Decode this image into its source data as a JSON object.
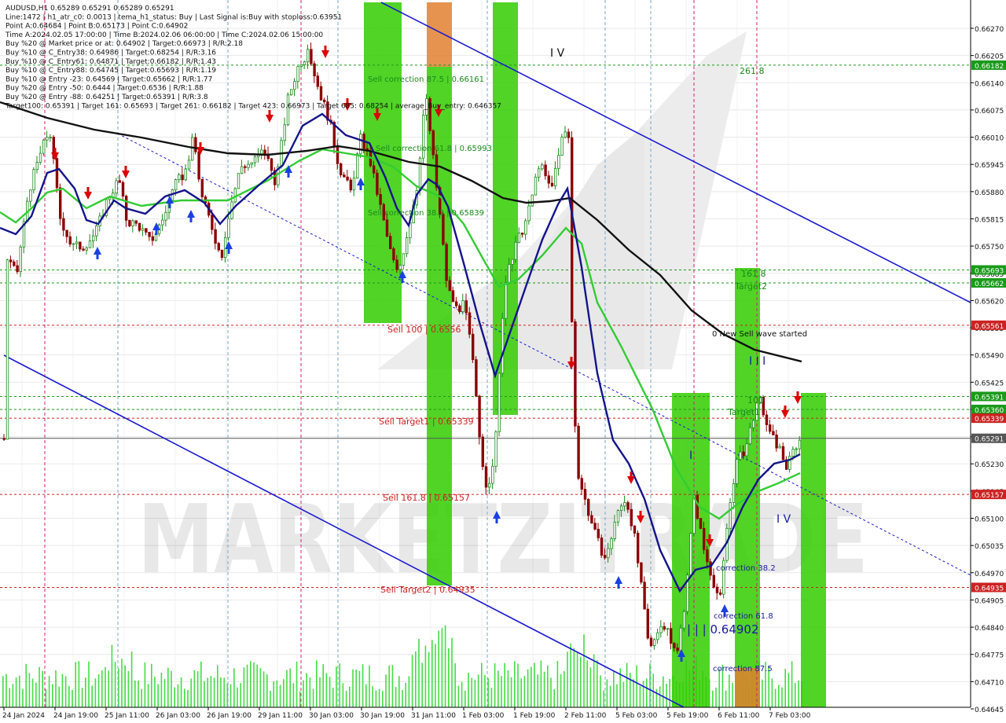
{
  "header": {
    "lines": [
      "AUDUSD,H1  0.65289 0.65291 0.65289 0.65291",
      "Line:1472  | h1_atr_c0: 0.0013 | tema_h1_status: Buy | Last Signal is:Buy with stoploss:0.63951",
      "Point A:0.64684 | Point B:0.65173 | Point C:0.64902",
      "Time A:2024.02.05 17:00:00 | Time B:2024.02.06 06:00:00 | Time C:2024.02.06 15:00:00",
      "Buy %20 @ Market price or at: 0.64902 | Target:0.66973 | R/R:2.18",
      "Buy %10 @ C_Entry38: 0.64986 | Target:0.68254 | R/R:3.16",
      "Buy %10 @ C_Entry61: 0.64871 | Target:0.66182 | R/R:1.43",
      "Buy %10 @ C_Entry88: 0.64745 | Target:0.65693 | R/R:1.19",
      "Buy %10 @ Entry -23: 0.64569 | Target:0.65662 | R/R:1.77",
      "Buy %20 @ Entry -50: 0.6444 | Target:0.6536 | R/R:1.88",
      "Buy %20 @ Entry -88: 0.64251 | Target:0.65391 | R/R:3.8",
      "Target100: 0.65391 | Target 161: 0.65693 | Target 261: 0.66182 | Target 423: 0.66973 | Target 685: 0.68254 | average_Buy_entry: 0.646357"
    ]
  },
  "watermark": "MARKETZITRADE",
  "chart_data": {
    "type": "candlestick",
    "symbol": "AUDUSD",
    "timeframe": "H1",
    "ylim": [
      0.64645,
      0.66295
    ],
    "y_ticks": [
      "0.66270",
      "0.66205",
      "0.66140",
      "0.66075",
      "0.66010",
      "0.65945",
      "0.65880",
      "0.65815",
      "0.65750",
      "0.65685",
      "0.65620",
      "0.65555",
      "0.65490",
      "0.65425",
      "0.65360",
      "0.65295",
      "0.65230",
      "0.65165",
      "0.65100",
      "0.65035",
      "0.64970",
      "0.64905",
      "0.64840",
      "0.64775",
      "0.64710",
      "0.64645"
    ],
    "x_ticks": [
      "24 Jan 2024",
      "24 Jan 19:00",
      "25 Jan 11:00",
      "26 Jan 03:00",
      "26 Jan 19:00",
      "29 Jan 11:00",
      "30 Jan 03:00",
      "30 Jan 19:00",
      "31 Jan 11:00",
      "1 Feb 03:00",
      "1 Feb 19:00",
      "2 Feb 11:00",
      "5 Feb 03:00",
      "5 Feb 19:00",
      "6 Feb 11:00",
      "7 Feb 03:00"
    ],
    "current_price": "0.65291",
    "levels": [
      {
        "price": 0.66182,
        "label": "0.66182",
        "color": "#1a9a1a",
        "style": "dashed"
      },
      {
        "price": 0.65693,
        "label": "0.65693",
        "color": "#1a9a1a",
        "style": "dashed"
      },
      {
        "price": 0.65662,
        "label": "0.65662",
        "color": "#1a9a1a",
        "style": "dashed"
      },
      {
        "price": 0.65561,
        "label": "0.65561",
        "color": "#cc2222",
        "style": "dashed"
      },
      {
        "price": 0.65391,
        "label": "0.65391",
        "color": "#1a9a1a",
        "style": "dashed"
      },
      {
        "price": 0.6536,
        "label": "0.65360",
        "color": "#1a9a1a",
        "style": "dashed"
      },
      {
        "price": 0.65339,
        "label": "0.65339",
        "color": "#cc2222",
        "style": "dashed"
      },
      {
        "price": 0.65291,
        "label": "0.65291",
        "color": "#555555",
        "style": "solid"
      },
      {
        "price": 0.65157,
        "label": "0.65157",
        "color": "#cc2222",
        "style": "dashed"
      },
      {
        "price": 0.64935,
        "label": "0.64935",
        "color": "#cc2222",
        "style": "dashed"
      }
    ],
    "annotations": [
      {
        "text": "Sell correction 87.5 | 0.66161",
        "price": 0.66161,
        "color": "#1a8a1a"
      },
      {
        "text": "Sell correction 61.8 | 0.65993",
        "price": 0.65993,
        "color": "#1a8a1a"
      },
      {
        "text": "Sell correction 38.2 | 0.65839",
        "price": 0.65839,
        "color": "#1a8a1a"
      },
      {
        "text": "Sell 100 | 0.6556",
        "price": 0.6556,
        "color": "#cc2222"
      },
      {
        "text": "Sell Target1 | 0.65339",
        "price": 0.65339,
        "color": "#cc2222"
      },
      {
        "text": "Sell 161.8 | 0.65157",
        "price": 0.65157,
        "color": "#cc2222"
      },
      {
        "text": "Sell Target2 | 0.64935",
        "price": 0.64935,
        "color": "#cc2222"
      },
      {
        "text": "261.8",
        "price": 0.66182,
        "color": "#1a8a1a"
      },
      {
        "text": "161.8",
        "price": 0.65693,
        "color": "#1a8a1a"
      },
      {
        "text": "Target2",
        "price": 0.65662,
        "color": "#1a8a1a"
      },
      {
        "text": "100",
        "price": 0.65391,
        "color": "#1a8a1a"
      },
      {
        "text": "Target1",
        "price": 0.6536,
        "color": "#1a8a1a"
      },
      {
        "text": "0 New Sell wave started",
        "price": 0.6554,
        "color": "#111111"
      },
      {
        "text": "correction 38.2",
        "price": 0.64986,
        "color": "#1a1aa0"
      },
      {
        "text": "correction 61.8",
        "price": 0.64871,
        "color": "#1a1aa0"
      },
      {
        "text": "correction 87.5",
        "price": 0.64745,
        "color": "#1a1aa0"
      },
      {
        "text": "| | | 0.64902",
        "price": 0.64902,
        "color": "#1a1aa0"
      },
      {
        "text": "I V",
        "price": 0.66225,
        "color": "#111111"
      },
      {
        "text": "I I I",
        "price": 0.65455,
        "color": "#1a1aa0"
      },
      {
        "text": "I V",
        "price": 0.65105,
        "color": "#1a1aa0"
      },
      {
        "text": "I",
        "price": 0.65235,
        "color": "#1a1aa0"
      }
    ],
    "series": [
      {
        "name": "MA slow",
        "color": "#111111"
      },
      {
        "name": "MA medium",
        "color": "#33cc33"
      },
      {
        "name": "TEMA",
        "color": "#14148c"
      }
    ]
  },
  "colors": {
    "bull": "#1a8a1a",
    "bear": "#8b0000",
    "zone_green": "#33cc00",
    "zone_orange": "#e08030",
    "channel": "#1a1ad0",
    "volume": "#44dd44",
    "background": "#ffffff",
    "grid": "#e8e8e8"
  }
}
